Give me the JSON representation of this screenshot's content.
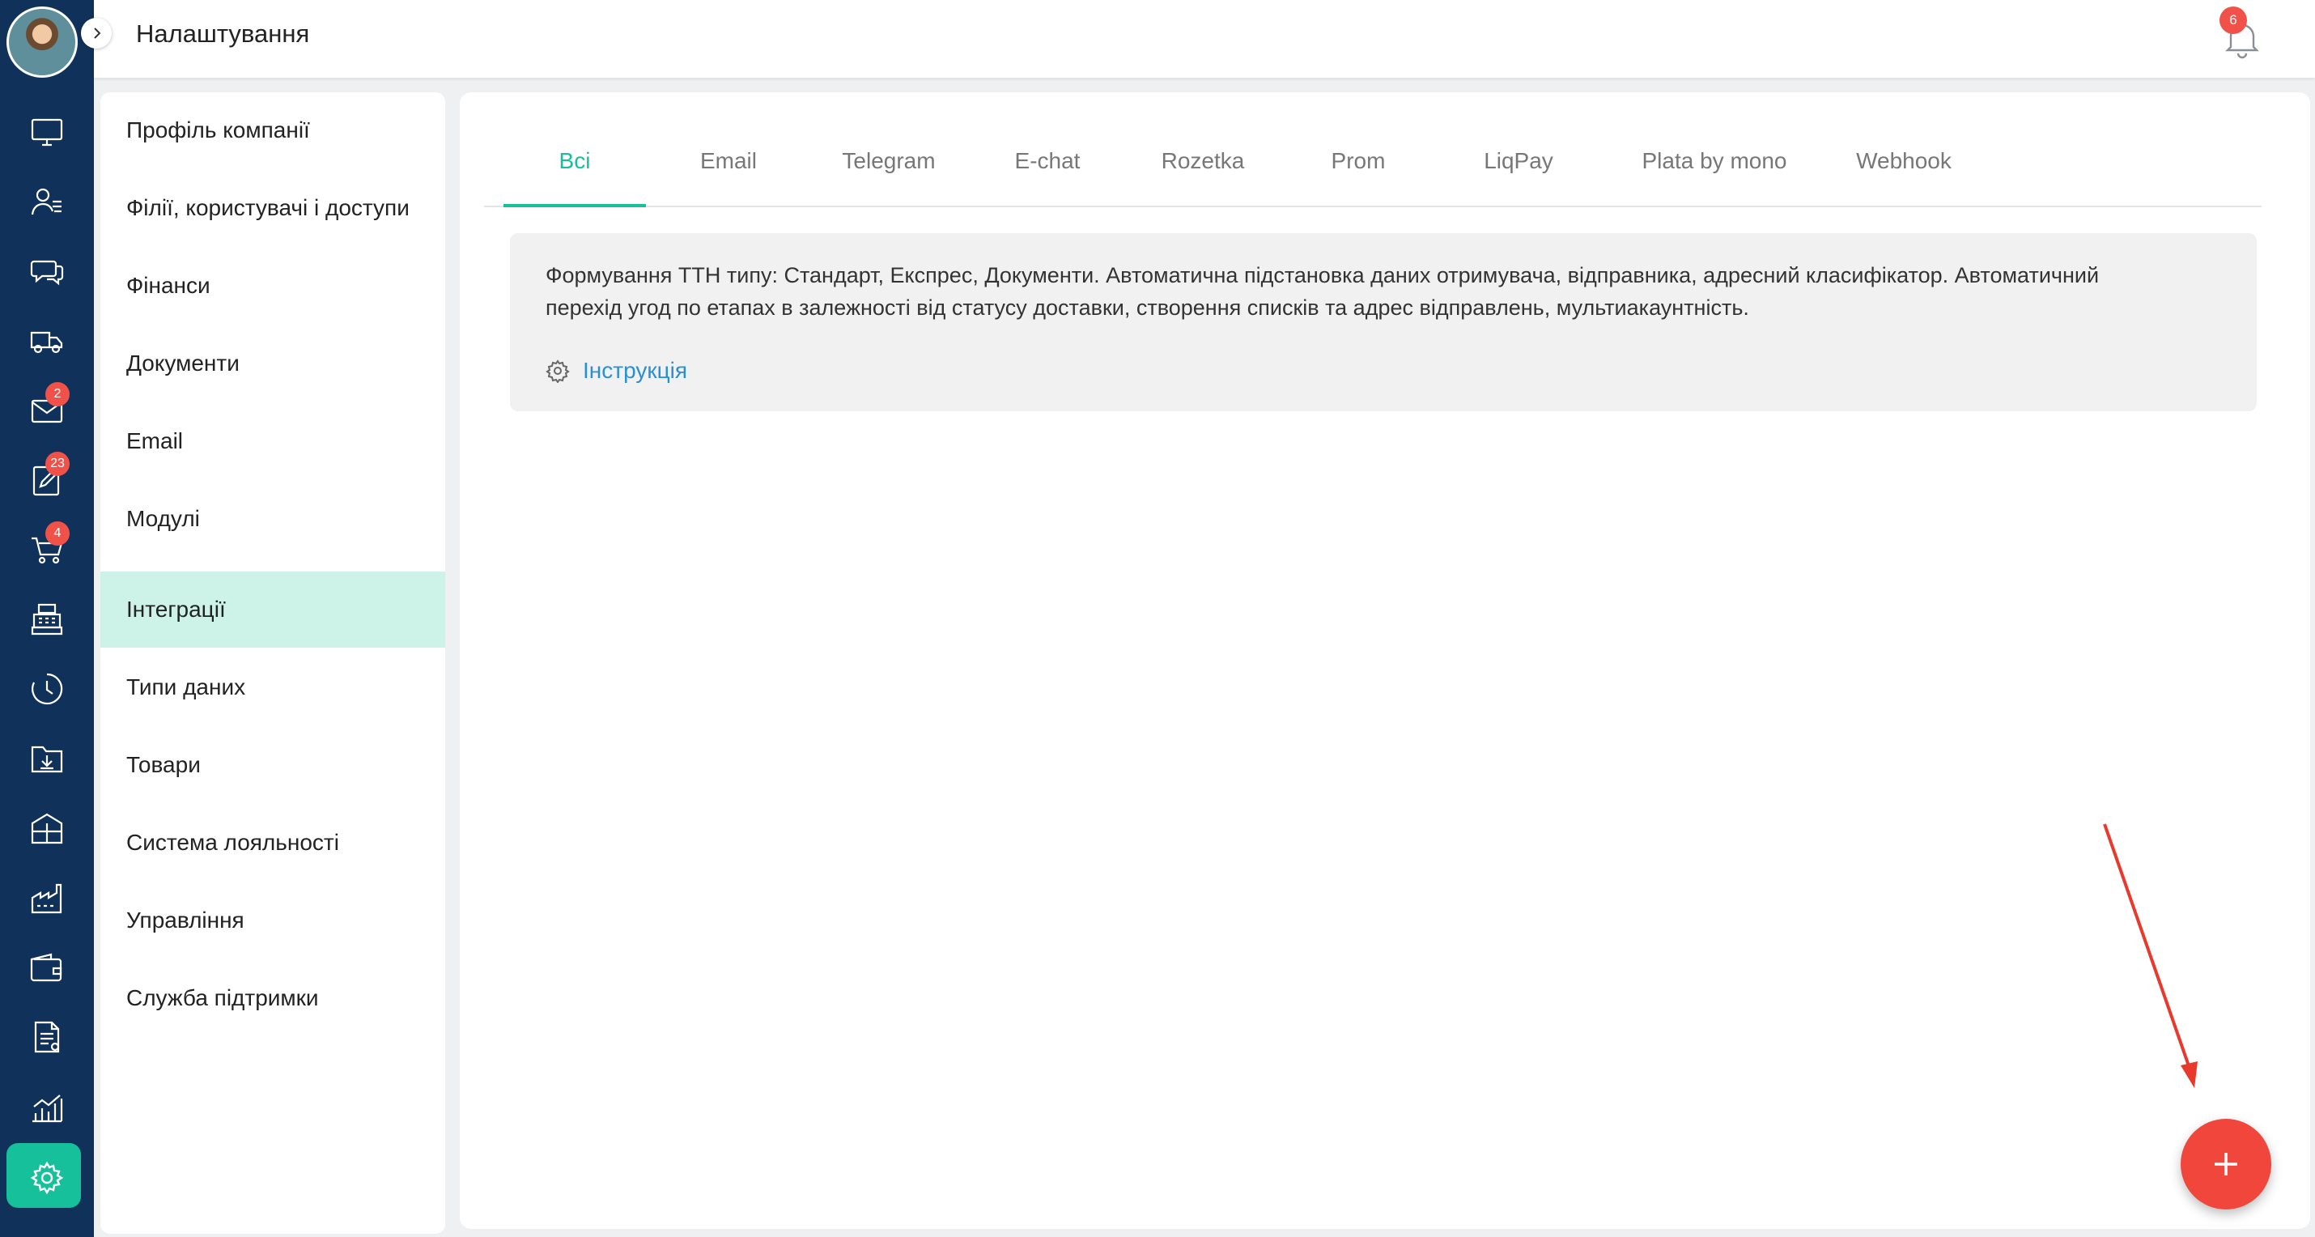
{
  "header": {
    "title": "Налаштування",
    "notifications_count": "6"
  },
  "rail": {
    "items": [
      {
        "icon": "monitor-icon"
      },
      {
        "icon": "contacts-icon"
      },
      {
        "icon": "chat-icon"
      },
      {
        "icon": "delivery-truck-icon"
      },
      {
        "icon": "mail-icon",
        "badge": "2"
      },
      {
        "icon": "tasks-icon",
        "badge": "23"
      },
      {
        "icon": "cart-icon",
        "badge": "4"
      },
      {
        "icon": "cash-register-icon"
      },
      {
        "icon": "clock-icon"
      },
      {
        "icon": "folder-download-icon"
      },
      {
        "icon": "warehouse-icon"
      },
      {
        "icon": "factory-icon"
      },
      {
        "icon": "wallet-icon"
      },
      {
        "icon": "document-icon"
      },
      {
        "icon": "analytics-icon"
      },
      {
        "icon": "settings-icon",
        "active": true
      }
    ]
  },
  "menu": {
    "items": [
      {
        "label": "Профіль компанії"
      },
      {
        "label": "Філії, користувачі і доступи"
      },
      {
        "label": "Фінанси"
      },
      {
        "label": "Документи"
      },
      {
        "label": "Email"
      },
      {
        "label": "Модулі"
      },
      {
        "label": "Інтеграції",
        "active": true
      },
      {
        "label": "Типи даних"
      },
      {
        "label": "Товари"
      },
      {
        "label": "Система лояльності"
      },
      {
        "label": "Управління"
      },
      {
        "label": "Служба підтримки"
      }
    ]
  },
  "tabs": [
    {
      "label": "Всі",
      "active": true
    },
    {
      "label": "Email"
    },
    {
      "label": "Telegram"
    },
    {
      "label": "E-chat"
    },
    {
      "label": "Rozetka"
    },
    {
      "label": "Prom"
    },
    {
      "label": "LiqPay"
    },
    {
      "label": "Plata by mono"
    },
    {
      "label": "Webhook"
    }
  ],
  "integration_card": {
    "description_line1": "Формування ТТН типу: Стандарт, Експрес, Документи. Автоматична підстановка даних отримувача, відправника, адресний класифікатор. Автоматичний",
    "description_line2": "перехід угод по етапах в залежності від статусу доставки, створення списків та адрес відправлень, мультиакаунтність.",
    "instruction_link": "Інструкція"
  },
  "colors": {
    "rail_bg": "#10325a",
    "accent": "#15c09a",
    "fab": "#f1463c",
    "badge": "#f0524a",
    "link": "#2a8fd4"
  }
}
